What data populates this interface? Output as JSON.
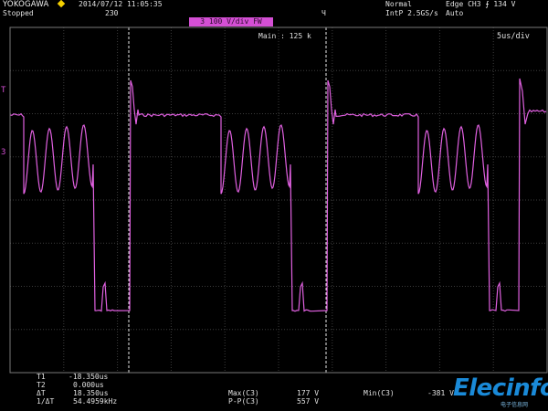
{
  "header": {
    "brand": "YOKOGAWA",
    "datetime": "2014/07/12 11:05:35",
    "status": "Stopped",
    "acq_count": "230",
    "mode": "Normal",
    "sample": "IntP 2.5GS/s",
    "trigger": "Edge CH3",
    "trigger_level": "134 V",
    "trigger_mode": "Auto",
    "channel_label": "3",
    "channel_scale": "100 V/div",
    "channel_coupling": "FW",
    "main_label": "Main : 125 k",
    "timebase": "5us/div",
    "trigger_pos_marker": "Ч"
  },
  "side_markers": {
    "trigger_marker": "T",
    "ground_marker": "3"
  },
  "measurements": {
    "t1_label": "T1",
    "t1_value": "-18.350us",
    "t2_label": "T2",
    "t2_value": "0.000us",
    "dt_label": "ΔT",
    "dt_value": "18.350us",
    "inv_dt_label": "1/ΔT",
    "inv_dt_value": "54.4959kHz",
    "max_label": "Max(C3)",
    "max_value": "177 V",
    "pp_label": "P-P(C3)",
    "pp_value": "557 V",
    "min_label": "Min(C3)",
    "min_value": "-381 V"
  },
  "watermark": {
    "text": "Elecinfo",
    "sub": "电子信息网"
  },
  "colors": {
    "trace": "#e060e0",
    "grid": "#3c3c3c",
    "channel_box": "#d44fd4",
    "logo": "#1a8ad8"
  },
  "chart_data": {
    "type": "line",
    "timebase": "5us/div",
    "volts_per_div": "100 V/div",
    "grid": true,
    "series": [
      {
        "values_v": [
          "per period: ~+100 V flat (~12 us), then 4-cycle ringing between ~-25 V and ~-130 V (~9 us), then sharp drop to ~-381 V (~2 us) with a spike to ~-300 V, then sharp rise with overshoot to 177 V"
        ]
      }
    ],
    "cursor_t1_us": -18.35,
    "cursor_t2_us": 0.0,
    "period_us": 18.35
  }
}
